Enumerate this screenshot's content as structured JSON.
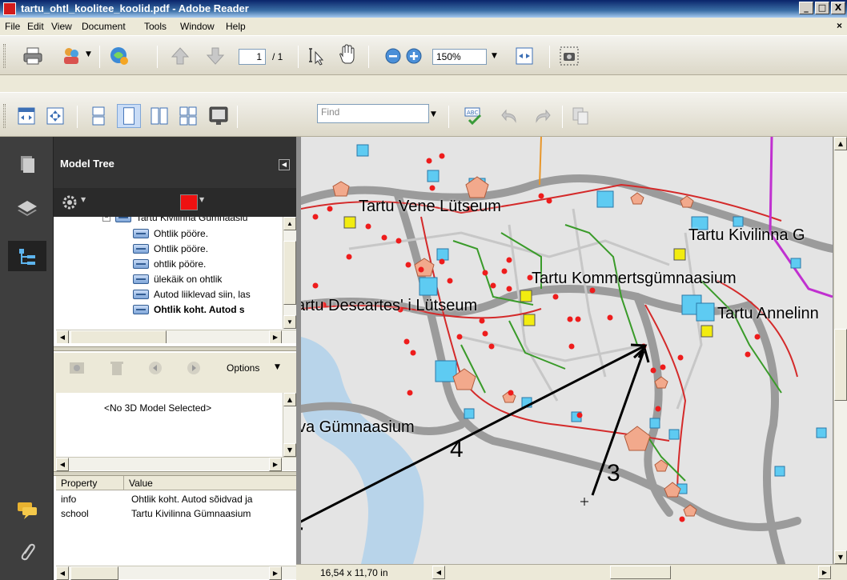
{
  "window": {
    "title": "tartu_ohtl_koolitee_koolid.pdf - Adobe Reader",
    "minimize": "_",
    "maximize": "□",
    "close": "X"
  },
  "menu": [
    "File",
    "Edit",
    "View",
    "Document",
    "Tools",
    "Window",
    "Help"
  ],
  "menu_close": "×",
  "toolbar": {
    "page_current": "1",
    "page_total": "/ 1",
    "zoom": "150%",
    "find_placeholder": "Find"
  },
  "model_tree": {
    "title": "Model Tree",
    "tree_items": [
      "Tartu Kivilinna Gümnaasiu",
      "Ohtlik pööre.",
      "Ohtlik pööre.",
      "ohtlik pööre.",
      "ülekäik on ohtlik",
      "Autod liiklevad siin, las",
      "Ohtlik koht. Autod s"
    ],
    "options_label": "Options",
    "no_model": "<No 3D Model Selected>",
    "props_headers": [
      "Property",
      "Value"
    ],
    "props_rows": [
      {
        "property": "info",
        "value": "Ohtlik koht. Autod sõidvad ja"
      },
      {
        "property": "school",
        "value": "Tartu Kivilinna Gümnaasium"
      }
    ]
  },
  "map": {
    "labels": [
      "Tartu Vene Lütseum",
      "Tartu Kivilinna G",
      "Tartu Kommertsgümnaasium",
      "artu Descartes' i Lütseum",
      "Tartu Annelinn",
      "va Gümnaasium"
    ],
    "annotations": [
      "4",
      "3"
    ]
  },
  "status": {
    "page_size": "16,54 x 11,70 in"
  }
}
